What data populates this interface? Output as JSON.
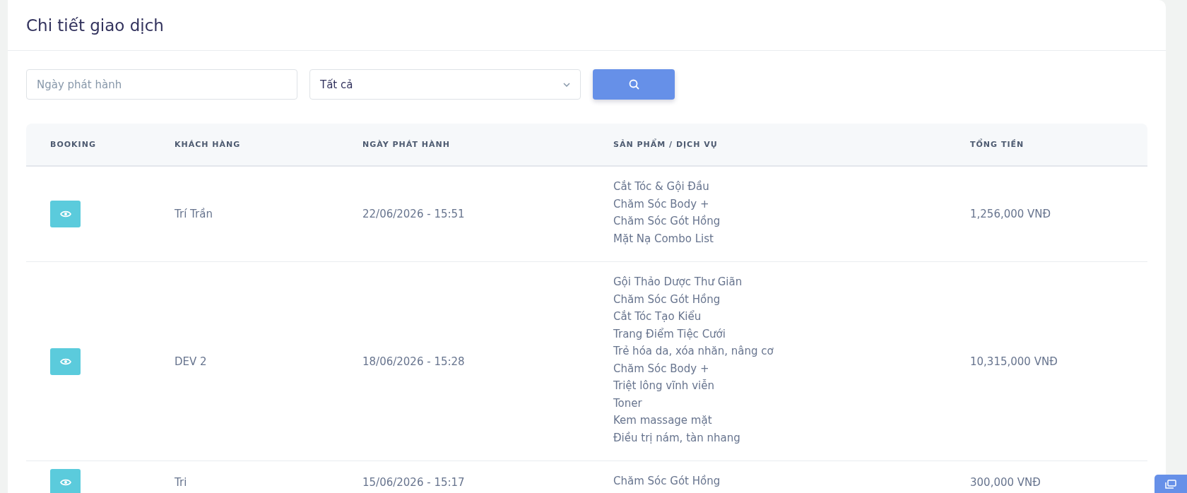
{
  "card": {
    "title": "Chi tiết giao dịch"
  },
  "filters": {
    "date": {
      "placeholder": "Ngày phát hành"
    },
    "status": {
      "value": "Tất cả"
    }
  },
  "table": {
    "columns": [
      "BOOKING",
      "KHÁCH HÀNG",
      "NGÀY PHÁT HÀNH",
      "SẢN PHẨM / DỊCH VỤ",
      "TỔNG TIỀN"
    ],
    "rows": [
      {
        "customer": "Trí Trần",
        "date": "22/06/2026 - 15:51",
        "products": [
          "Cắt Tóc & Gội Đầu",
          "Chăm Sóc Body +",
          "Chăm Sóc Gót Hồng",
          "Mặt Nạ Combo List"
        ],
        "total": "1,256,000 VNĐ"
      },
      {
        "customer": "DEV 2",
        "date": "18/06/2026 - 15:28",
        "products": [
          "Gội Thảo Dược Thư Giãn",
          "Chăm Sóc Gót Hồng",
          "Cắt Tóc Tạo Kiểu",
          "Trang Điểm Tiệc Cưới",
          "Trẻ hóa da, xóa nhăn, nâng cơ",
          "Chăm Sóc Body +",
          "Triệt lông vĩnh viễn",
          "Toner",
          "Kem massage mặt",
          "Điều trị nám, tàn nhang"
        ],
        "total": "10,315,000 VNĐ"
      },
      {
        "customer": "Tri",
        "date": "15/06/2026 - 15:17",
        "products": [
          "Chăm Sóc Gót Hồng"
        ],
        "total": "300,000 VNĐ"
      }
    ]
  }
}
